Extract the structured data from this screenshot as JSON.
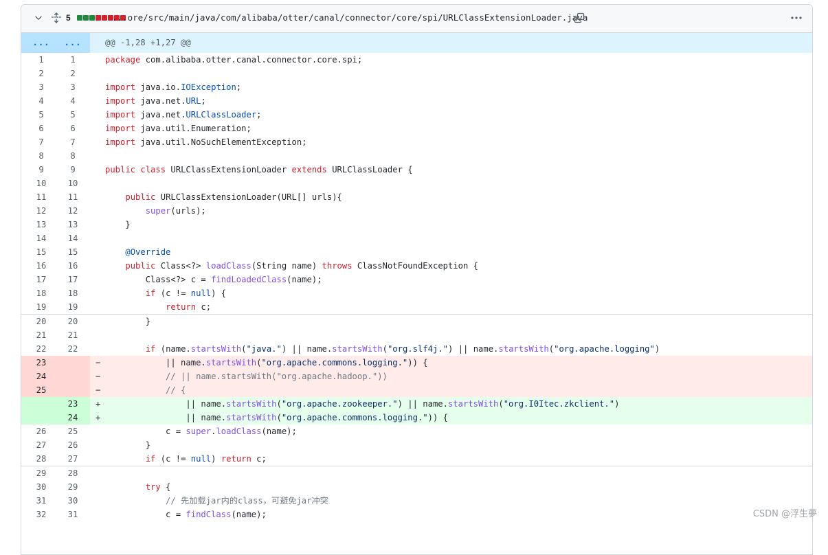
{
  "file": {
    "changes_count": "5",
    "diffstat": [
      "add",
      "add",
      "add",
      "del",
      "del",
      "del",
      "del",
      "del"
    ],
    "path": "...ore/src/main/java/com/alibaba/otter/canal/connector/core/spi/URLClassExtensionLoader.java"
  },
  "hunk": {
    "left": "...",
    "right": "...",
    "header": "@@ -1,28 +1,27 @@"
  },
  "lines": [
    {
      "o": "1",
      "n": "1",
      "t": "ctx",
      "c": [
        [
          "kw",
          "package"
        ],
        [
          "",
          "com.alibaba.otter.canal.connector.core.spi;"
        ]
      ]
    },
    {
      "o": "2",
      "n": "2",
      "t": "ctx",
      "c": []
    },
    {
      "o": "3",
      "n": "3",
      "t": "ctx",
      "c": [
        [
          "kw",
          "import"
        ],
        [
          "",
          "java.io."
        ],
        [
          "ty",
          "IOException"
        ],
        [
          "",
          ";"
        ]
      ]
    },
    {
      "o": "4",
      "n": "4",
      "t": "ctx",
      "c": [
        [
          "kw",
          "import"
        ],
        [
          "",
          "java.net."
        ],
        [
          "ty",
          "URL"
        ],
        [
          "",
          ";"
        ]
      ]
    },
    {
      "o": "5",
      "n": "5",
      "t": "ctx",
      "c": [
        [
          "kw",
          "import"
        ],
        [
          "",
          "java.net."
        ],
        [
          "ty",
          "URLClassLoader"
        ],
        [
          "",
          ";"
        ]
      ]
    },
    {
      "o": "6",
      "n": "6",
      "t": "ctx",
      "c": [
        [
          "kw",
          "import"
        ],
        [
          "",
          "java.util.Enumeration;"
        ]
      ]
    },
    {
      "o": "7",
      "n": "7",
      "t": "ctx",
      "c": [
        [
          "kw",
          "import"
        ],
        [
          "",
          "java.util.NoSuchElementException;"
        ]
      ]
    },
    {
      "o": "8",
      "n": "8",
      "t": "ctx",
      "c": []
    },
    {
      "o": "9",
      "n": "9",
      "t": "ctx",
      "c": [
        [
          "kw",
          "public class"
        ],
        [
          "",
          " URLClassExtensionLoader "
        ],
        [
          "kw",
          "extends"
        ],
        [
          "",
          " URLClassLoader {"
        ]
      ]
    },
    {
      "o": "10",
      "n": "10",
      "t": "ctx",
      "c": []
    },
    {
      "o": "11",
      "n": "11",
      "t": "ctx",
      "c": [
        [
          "",
          "    "
        ],
        [
          "kw",
          "public"
        ],
        [
          "",
          " URLClassExtensionLoader(URL[] urls){"
        ]
      ]
    },
    {
      "o": "12",
      "n": "12",
      "t": "ctx",
      "c": [
        [
          "",
          "        "
        ],
        [
          "fn",
          "super"
        ],
        [
          "",
          "(urls);"
        ]
      ]
    },
    {
      "o": "13",
      "n": "13",
      "t": "ctx",
      "c": [
        [
          "",
          "    }"
        ]
      ]
    },
    {
      "o": "14",
      "n": "14",
      "t": "ctx",
      "c": []
    },
    {
      "o": "15",
      "n": "15",
      "t": "ctx",
      "c": [
        [
          "",
          "    "
        ],
        [
          "an",
          "@Override"
        ]
      ]
    },
    {
      "o": "16",
      "n": "16",
      "t": "ctx",
      "c": [
        [
          "",
          "    "
        ],
        [
          "kw",
          "public"
        ],
        [
          "",
          " Class<?> "
        ],
        [
          "fn",
          "loadClass"
        ],
        [
          "",
          "(String name) "
        ],
        [
          "kw",
          "throws"
        ],
        [
          "",
          " ClassNotFoundException {"
        ]
      ]
    },
    {
      "o": "17",
      "n": "17",
      "t": "ctx",
      "c": [
        [
          "",
          "        Class<?> c = "
        ],
        [
          "fn",
          "findLoadedClass"
        ],
        [
          "",
          "(name);"
        ]
      ]
    },
    {
      "o": "18",
      "n": "18",
      "t": "ctx",
      "c": [
        [
          "",
          "        "
        ],
        [
          "kw",
          "if"
        ],
        [
          "",
          " (c != "
        ],
        [
          "ty",
          "null"
        ],
        [
          "",
          ") {"
        ]
      ]
    },
    {
      "o": "19",
      "n": "19",
      "t": "ctx",
      "c": [
        [
          "",
          "            "
        ],
        [
          "kw",
          "return"
        ],
        [
          "",
          " c;"
        ]
      ]
    },
    {
      "o": "20",
      "n": "20",
      "t": "ctx",
      "sep": true,
      "c": [
        [
          "",
          "        }"
        ]
      ]
    },
    {
      "o": "21",
      "n": "21",
      "t": "ctx",
      "c": []
    },
    {
      "o": "22",
      "n": "22",
      "t": "ctx",
      "c": [
        [
          "",
          "        "
        ],
        [
          "kw",
          "if"
        ],
        [
          "",
          " (name."
        ],
        [
          "fn",
          "startsWith"
        ],
        [
          "",
          "("
        ],
        [
          "str",
          "\"java.\""
        ],
        [
          "",
          ") || name."
        ],
        [
          "fn",
          "startsWith"
        ],
        [
          "",
          "("
        ],
        [
          "str",
          "\"org.slf4j.\""
        ],
        [
          "",
          ") || name."
        ],
        [
          "fn",
          "startsWith"
        ],
        [
          "",
          "("
        ],
        [
          "str",
          "\"org.apache.logging\""
        ],
        [
          "",
          ")"
        ]
      ]
    },
    {
      "o": "23",
      "n": "",
      "t": "del",
      "c": [
        [
          "",
          "            || name."
        ],
        [
          "fn",
          "startsWith"
        ],
        [
          "",
          "("
        ],
        [
          "str",
          "\"org.apache.commons.logging.\""
        ],
        [
          "",
          ")) {"
        ]
      ]
    },
    {
      "o": "24",
      "n": "",
      "t": "del",
      "c": [
        [
          "cm",
          "            // || name.startsWith(\"org.apache.hadoop.\"))"
        ]
      ]
    },
    {
      "o": "25",
      "n": "",
      "t": "del",
      "c": [
        [
          "cm",
          "            // {"
        ]
      ]
    },
    {
      "o": "",
      "n": "23",
      "t": "add",
      "c": [
        [
          "",
          "                || name."
        ],
        [
          "fn",
          "startsWith"
        ],
        [
          "",
          "("
        ],
        [
          "str",
          "\"org.apache.zookeeper.\""
        ],
        [
          "",
          ") || name."
        ],
        [
          "fn",
          "startsWith"
        ],
        [
          "",
          "("
        ],
        [
          "str",
          "\"org.I0Itec.zkclient.\""
        ],
        [
          "",
          ")"
        ]
      ]
    },
    {
      "o": "",
      "n": "24",
      "t": "add",
      "c": [
        [
          "",
          "                || name."
        ],
        [
          "fn",
          "startsWith"
        ],
        [
          "",
          "("
        ],
        [
          "str",
          "\"org.apache.commons.logging.\""
        ],
        [
          "",
          ")) {"
        ]
      ]
    },
    {
      "o": "26",
      "n": "25",
      "t": "ctx",
      "c": [
        [
          "",
          "            c = "
        ],
        [
          "fn",
          "super"
        ],
        [
          "",
          "."
        ],
        [
          "fn",
          "loadClass"
        ],
        [
          "",
          "(name);"
        ]
      ]
    },
    {
      "o": "27",
      "n": "26",
      "t": "ctx",
      "c": [
        [
          "",
          "        }"
        ]
      ]
    },
    {
      "o": "28",
      "n": "27",
      "t": "ctx",
      "c": [
        [
          "",
          "        "
        ],
        [
          "kw",
          "if"
        ],
        [
          "",
          " (c != "
        ],
        [
          "ty",
          "null"
        ],
        [
          "",
          ") "
        ],
        [
          "kw",
          "return"
        ],
        [
          "",
          " c;"
        ]
      ]
    },
    {
      "o": "29",
      "n": "28",
      "t": "ctx",
      "sep": true,
      "c": []
    },
    {
      "o": "30",
      "n": "29",
      "t": "ctx",
      "c": [
        [
          "",
          "        "
        ],
        [
          "kw",
          "try"
        ],
        [
          "",
          " {"
        ]
      ]
    },
    {
      "o": "31",
      "n": "30",
      "t": "ctx",
      "c": [
        [
          "cm",
          "            // 先加载jar内的class，可避免jar冲突"
        ]
      ]
    },
    {
      "o": "32",
      "n": "31",
      "t": "ctx",
      "c": [
        [
          "",
          "            c = "
        ],
        [
          "fn",
          "findClass"
        ],
        [
          "",
          "(name);"
        ]
      ]
    }
  ],
  "watermark": "CSDN @浮生夢"
}
